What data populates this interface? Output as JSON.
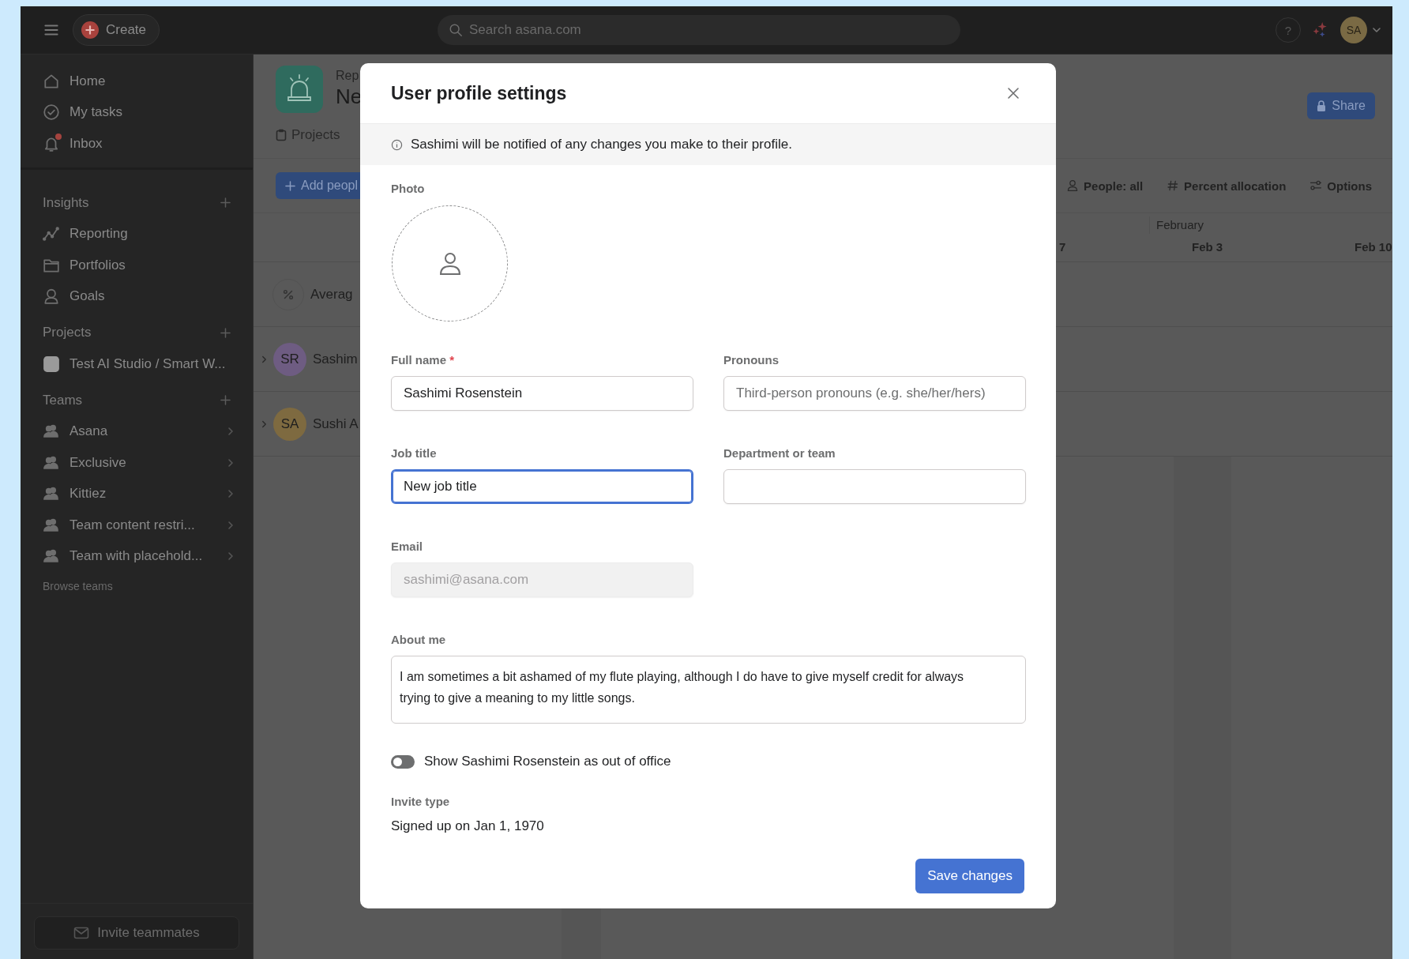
{
  "topbar": {
    "create_label": "Create",
    "search": {
      "placeholder": "Search asana.com"
    },
    "help_label": "?",
    "avatar": {
      "initials": "SA",
      "color": "#7a6a44"
    }
  },
  "sidebar": {
    "nav": [
      {
        "label": "Home",
        "kind": "home",
        "notification": false
      },
      {
        "label": "My tasks",
        "kind": "check",
        "notification": false
      },
      {
        "label": "Inbox",
        "kind": "bell",
        "notification": true
      }
    ],
    "sections": [
      {
        "title": "Insights",
        "items": [
          {
            "label": "Reporting",
            "kind": "chart"
          },
          {
            "label": "Portfolios",
            "kind": "folder"
          },
          {
            "label": "Goals",
            "kind": "goal"
          }
        ]
      },
      {
        "title": "Projects",
        "items": [
          {
            "label": "Test AI Studio / Smart W...",
            "kind": "square"
          }
        ]
      },
      {
        "title": "Teams",
        "items": [
          {
            "label": "Asana",
            "kind": "team"
          },
          {
            "label": "Exclusive",
            "kind": "team"
          },
          {
            "label": "Kittiez",
            "kind": "team"
          },
          {
            "label": "Team content restri...",
            "kind": "team"
          },
          {
            "label": "Team with placehold...",
            "kind": "team"
          }
        ],
        "link": "Browse teams"
      }
    ],
    "invite_button": "Invite teammates"
  },
  "page": {
    "header": {
      "eyebrow": "Rep",
      "title": "Ne",
      "tab": "Projects",
      "share_button": "Share"
    },
    "toolbar": {
      "add_button": "Add peopl",
      "filters": [
        {
          "label": "People: all",
          "kind": "person"
        },
        {
          "label": "Percent allocation",
          "kind": "hash"
        },
        {
          "label": "Options",
          "kind": "options"
        }
      ]
    },
    "timeline": {
      "month": "February",
      "dates": [
        "7",
        "Feb 3",
        "Feb 10"
      ]
    },
    "rows": [
      {
        "kind": "summary",
        "label": "Averag"
      },
      {
        "kind": "person",
        "initials": "SR",
        "label": "Sashim",
        "color": "#6e5c82"
      },
      {
        "kind": "person",
        "initials": "SA",
        "label": "Sushi A",
        "color": "#7e6a40"
      }
    ]
  },
  "dialog": {
    "title": "User profile settings",
    "notice": "Sashimi will be notified of any changes you make to their profile.",
    "photo_label": "Photo",
    "fields": [
      {
        "kind": "input",
        "label": "Full name",
        "required_mark": "*",
        "value": "Sashimi Rosenstein",
        "focused": false,
        "disabled": false
      },
      {
        "kind": "input",
        "label": "Pronouns",
        "placeholder": "Third-person pronouns (e.g. she/her/hers)",
        "focused": false,
        "disabled": false
      },
      {
        "kind": "input",
        "label": "Job title",
        "value": "New job title",
        "focused": true,
        "disabled": false
      },
      {
        "kind": "input",
        "label": "Department or team",
        "focused": false,
        "disabled": false
      },
      {
        "kind": "input",
        "label": "Email",
        "value": "sashimi@asana.com",
        "focused": false,
        "disabled": true
      },
      {
        "kind": "textarea",
        "label": "About me",
        "value": "I am sometimes a bit ashamed of my flute playing, although I do have to give myself credit for always trying to give a meaning to my little songs.",
        "focused": false,
        "disabled": false
      }
    ],
    "toggle": {
      "label": "Show Sashimi Rosenstein as out of office",
      "on": false
    },
    "invite": {
      "label": "Invite type",
      "value": "Signed up on Jan 1, 1970"
    },
    "save_button": "Save changes"
  }
}
